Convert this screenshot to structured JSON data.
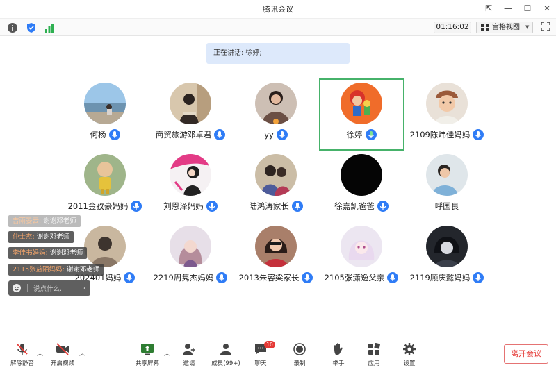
{
  "window": {
    "title": "腾讯会议"
  },
  "topbar": {
    "timer": "01:16:02",
    "view_label": "宫格视图"
  },
  "speaking": {
    "text": "正在讲话: 徐婷;"
  },
  "participants": [
    {
      "name": "何杨",
      "mic": "on"
    },
    {
      "name": "商贸旅游邓卓君",
      "mic": "on"
    },
    {
      "name": "yy",
      "mic": "on"
    },
    {
      "name": "徐婷",
      "mic": "speaking",
      "active": true
    },
    {
      "name": "2109陈炜佳妈妈",
      "mic": "on"
    },
    {
      "name": "2011金孜豪妈妈",
      "mic": "on"
    },
    {
      "name": "刘恩泽妈妈",
      "mic": "on"
    },
    {
      "name": "陆鸿涛家长",
      "mic": "on"
    },
    {
      "name": "徐嘉凯爸爸",
      "mic": "on"
    },
    {
      "name": "呼国良",
      "mic": "none"
    },
    {
      "name": "202401妈妈",
      "mic": "on"
    },
    {
      "name": "2219周隽杰妈妈",
      "mic": "on"
    },
    {
      "name": "2013朱容梁家长",
      "mic": "on"
    },
    {
      "name": "2105张潇逸父亲",
      "mic": "on"
    },
    {
      "name": "2119顾庆懿妈妈",
      "mic": "on"
    }
  ],
  "chat": {
    "messages": [
      {
        "sender": "吉雨晏云:",
        "text": "谢谢邓老师",
        "faded": true
      },
      {
        "sender": "仲士杰:",
        "text": "谢谢邓老师",
        "faded": false
      },
      {
        "sender": "李佳书妈妈:",
        "text": "谢谢邓老师",
        "faded": false
      },
      {
        "sender": "2115张益陌妈妈:",
        "text": "谢谢邓老师",
        "faded": false
      }
    ],
    "input_placeholder": "说点什么..."
  },
  "bottom": {
    "unmute": "解除静音",
    "start_video": "开启视频",
    "share_screen": "共享屏幕",
    "invite": "邀请",
    "members": "成员(99+)",
    "chat": "聊天",
    "chat_badge": "10",
    "record": "录制",
    "raise_hand": "举手",
    "apps": "应用",
    "settings": "设置",
    "leave": "离开会议"
  },
  "colors": {
    "accent": "#2f7cf6",
    "active_border": "#46b26a",
    "leave": "#e53935",
    "speaking_bg": "#dde9fb"
  }
}
